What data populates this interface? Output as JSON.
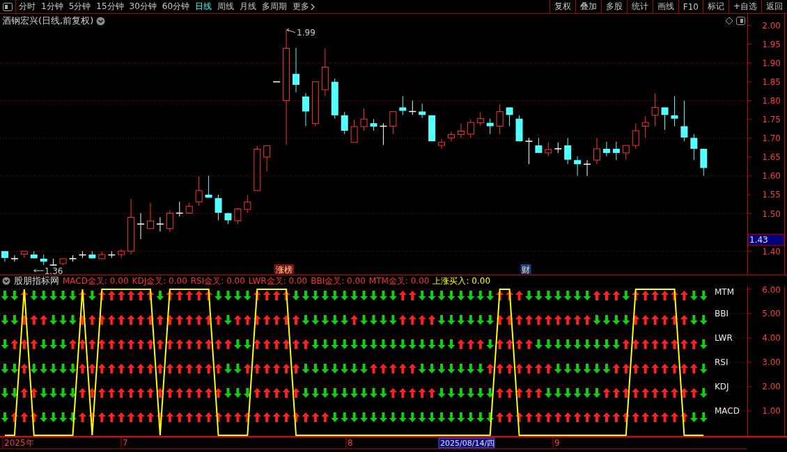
{
  "toolbar": {
    "periods": [
      {
        "label": "分时",
        "selected": false
      },
      {
        "label": "1分钟",
        "selected": false
      },
      {
        "label": "5分钟",
        "selected": false
      },
      {
        "label": "15分钟",
        "selected": false
      },
      {
        "label": "30分钟",
        "selected": false
      },
      {
        "label": "60分钟",
        "selected": false
      },
      {
        "label": "日线",
        "selected": true
      },
      {
        "label": "周线",
        "selected": false
      },
      {
        "label": "月线",
        "selected": false
      },
      {
        "label": "多周期",
        "selected": false
      }
    ],
    "more": "更多",
    "actions": [
      "复权",
      "叠加",
      "多股",
      "统计",
      "画线",
      "F10",
      "标记",
      "+自选",
      "返回"
    ]
  },
  "price_panel": {
    "title": "酒钢宏兴(日线,前复权)",
    "current_price": "1.43",
    "tags": [
      {
        "text": "涨榜",
        "color": "#7a1414"
      },
      {
        "text": "财",
        "color": "#1b3f8f"
      }
    ],
    "chart_data": {
      "type": "candlestick",
      "grid": true,
      "ylim": [
        1.3375,
        2.0304
      ],
      "yticks": [
        {
          "value": 2.0,
          "label": "2.00"
        },
        {
          "value": 1.95,
          "label": "1.95"
        },
        {
          "value": 1.9,
          "label": "1.90"
        },
        {
          "value": 1.85,
          "label": "1.85"
        },
        {
          "value": 1.8,
          "label": "1.80"
        },
        {
          "value": 1.75,
          "label": "1.75"
        },
        {
          "value": 1.7,
          "label": "1.70"
        },
        {
          "value": 1.65,
          "label": "1.65"
        },
        {
          "value": 1.6,
          "label": "1.60"
        },
        {
          "value": 1.55,
          "label": "1.55"
        },
        {
          "value": 1.5,
          "label": "1.50"
        },
        {
          "value": 1.4,
          "label": "1.40"
        }
      ],
      "categories": [
        null,
        null,
        null,
        null,
        null,
        null,
        null,
        null,
        null,
        null,
        null,
        null,
        null,
        null,
        null,
        null,
        null,
        null,
        null,
        null,
        null,
        null,
        null,
        null,
        null,
        null,
        null,
        null,
        null,
        null,
        null,
        null,
        null,
        null,
        null,
        null,
        null,
        null,
        null,
        null,
        null,
        null,
        null,
        null,
        null,
        null,
        null,
        null,
        null,
        null,
        null,
        null,
        null,
        null,
        null,
        null,
        null,
        null,
        null,
        null,
        null,
        null,
        null,
        null,
        null,
        null,
        null,
        null,
        null,
        null,
        null,
        null,
        null,
        null,
        null,
        null,
        null
      ],
      "ohlc": [
        [
          1.4,
          1.4,
          1.372,
          1.382
        ],
        [
          1.38,
          1.389,
          1.372,
          1.38
        ],
        [
          1.392,
          1.4,
          1.382,
          1.4
        ],
        [
          1.391,
          1.4,
          1.381,
          1.381
        ],
        [
          1.38,
          1.391,
          1.363,
          1.372
        ],
        [
          1.363,
          1.38,
          1.363,
          1.363
        ],
        [
          1.367,
          1.38,
          1.363,
          1.38
        ],
        [
          1.38,
          1.389,
          1.372,
          1.38
        ],
        [
          1.39,
          1.4,
          1.382,
          1.39
        ],
        [
          1.391,
          1.4,
          1.381,
          1.381
        ],
        [
          1.38,
          1.4,
          1.38,
          1.391
        ],
        [
          1.39,
          1.4,
          1.382,
          1.39
        ],
        [
          1.391,
          1.405,
          1.382,
          1.4
        ],
        [
          1.4,
          1.539,
          1.392,
          1.49
        ],
        [
          1.472,
          1.501,
          1.432,
          1.472
        ],
        [
          1.46,
          1.529,
          1.46,
          1.48
        ],
        [
          1.472,
          1.49,
          1.452,
          1.472
        ],
        [
          1.46,
          1.509,
          1.452,
          1.501
        ],
        [
          1.501,
          1.531,
          1.492,
          1.501
        ],
        [
          1.501,
          1.529,
          1.501,
          1.519
        ],
        [
          1.531,
          1.599,
          1.521,
          1.561
        ],
        [
          1.55,
          1.6,
          1.542,
          1.542
        ],
        [
          1.541,
          1.55,
          1.482,
          1.502
        ],
        [
          1.501,
          1.501,
          1.472,
          1.482
        ],
        [
          1.481,
          1.515,
          1.472,
          1.512
        ],
        [
          1.511,
          1.549,
          1.502,
          1.531
        ],
        [
          1.561,
          1.679,
          1.561,
          1.671
        ],
        [
          1.65,
          1.68,
          1.612,
          1.68
        ],
        [
          1.85,
          1.85,
          1.85,
          1.85
        ],
        [
          1.8,
          1.99,
          1.682,
          1.939
        ],
        [
          1.871,
          1.94,
          1.822,
          1.842
        ],
        [
          1.811,
          1.82,
          1.732,
          1.771
        ],
        [
          1.739,
          1.85,
          1.732,
          1.85
        ],
        [
          1.829,
          1.939,
          1.812,
          1.889
        ],
        [
          1.85,
          1.859,
          1.752,
          1.761
        ],
        [
          1.761,
          1.77,
          1.711,
          1.72
        ],
        [
          1.689,
          1.749,
          1.689,
          1.731
        ],
        [
          1.731,
          1.779,
          1.72,
          1.751
        ],
        [
          1.74,
          1.751,
          1.72,
          1.731
        ],
        [
          1.732,
          1.74,
          1.682,
          1.732
        ],
        [
          1.732,
          1.771,
          1.711,
          1.771
        ],
        [
          1.782,
          1.812,
          1.762,
          1.773
        ],
        [
          1.771,
          1.8,
          1.762,
          1.771
        ],
        [
          1.771,
          1.792,
          1.754,
          1.762
        ],
        [
          1.761,
          1.761,
          1.692,
          1.692
        ],
        [
          1.681,
          1.698,
          1.672,
          1.689
        ],
        [
          1.701,
          1.718,
          1.692,
          1.71
        ],
        [
          1.71,
          1.739,
          1.701,
          1.719
        ],
        [
          1.711,
          1.75,
          1.701,
          1.742
        ],
        [
          1.741,
          1.769,
          1.733,
          1.752
        ],
        [
          1.741,
          1.752,
          1.711,
          1.732
        ],
        [
          1.732,
          1.79,
          1.711,
          1.771
        ],
        [
          1.782,
          1.782,
          1.732,
          1.762
        ],
        [
          1.752,
          1.761,
          1.692,
          1.692
        ],
        [
          1.692,
          1.701,
          1.631,
          1.692
        ],
        [
          1.681,
          1.701,
          1.661,
          1.661
        ],
        [
          1.661,
          1.689,
          1.652,
          1.67
        ],
        [
          1.672,
          1.689,
          1.661,
          1.672
        ],
        [
          1.681,
          1.701,
          1.631,
          1.643
        ],
        [
          1.642,
          1.652,
          1.6,
          1.631
        ],
        [
          1.631,
          1.642,
          1.6,
          1.631
        ],
        [
          1.642,
          1.701,
          1.631,
          1.672
        ],
        [
          1.672,
          1.691,
          1.652,
          1.661
        ],
        [
          1.672,
          1.691,
          1.642,
          1.661
        ],
        [
          1.661,
          1.681,
          1.643,
          1.681
        ],
        [
          1.681,
          1.739,
          1.672,
          1.72
        ],
        [
          1.732,
          1.759,
          1.701,
          1.742
        ],
        [
          1.761,
          1.819,
          1.732,
          1.782
        ],
        [
          1.782,
          1.782,
          1.722,
          1.762
        ],
        [
          1.761,
          1.812,
          1.732,
          1.752
        ],
        [
          1.732,
          1.8,
          1.692,
          1.702
        ],
        [
          1.701,
          1.711,
          1.642,
          1.672
        ],
        [
          1.672,
          1.672,
          1.6,
          1.621
        ],
        null,
        null,
        null,
        null
      ],
      "annotations": [
        "1.99",
        "1.36"
      ]
    }
  },
  "indicator": {
    "name": "股朋指标网",
    "legend": [
      {
        "text": "MACD金叉: 0.00",
        "color": "#ff3232"
      },
      {
        "text": "KDJ金叉: 0.00",
        "color": "#ff3232"
      },
      {
        "text": "RSI金叉: 0.00",
        "color": "#ff3232"
      },
      {
        "text": "LWR金叉: 0.00",
        "color": "#ff3232"
      },
      {
        "text": "BBI金叉: 0.00",
        "color": "#ff3232"
      },
      {
        "text": "MTM金叉: 0.00",
        "color": "#ff3232"
      },
      {
        "text": "上涨买入: 0.00",
        "color": "#ffff00"
      }
    ],
    "signals": [
      {
        "name": "MTM",
        "up": [
          false,
          false,
          true,
          false,
          false,
          false,
          false,
          false,
          true,
          false,
          true,
          true,
          true,
          true,
          true,
          true,
          false,
          true,
          true,
          true,
          true,
          true,
          false,
          false,
          false,
          false,
          true,
          true,
          true,
          true,
          false,
          false,
          false,
          false,
          false,
          false,
          false,
          false,
          false,
          false,
          false,
          true,
          true,
          false,
          false,
          false,
          false,
          false,
          false,
          false,
          false,
          true,
          true,
          true,
          false,
          false,
          false,
          false,
          false,
          false,
          false,
          true,
          true,
          true,
          false,
          true,
          true,
          true,
          true,
          true,
          true,
          false,
          false
        ]
      },
      {
        "name": "BBI",
        "up": [
          false,
          false,
          true,
          true,
          true,
          false,
          false,
          false,
          true,
          true,
          true,
          true,
          true,
          true,
          true,
          true,
          true,
          true,
          true,
          true,
          true,
          true,
          true,
          false,
          true,
          true,
          true,
          true,
          true,
          true,
          true,
          false,
          false,
          false,
          false,
          false,
          true,
          false,
          false,
          false,
          false,
          true,
          true,
          true,
          true,
          false,
          false,
          false,
          false,
          false,
          false,
          true,
          true,
          true,
          true,
          true,
          true,
          true,
          true,
          true,
          true,
          false,
          false,
          false,
          false,
          true,
          true,
          true,
          true,
          true,
          true,
          false,
          false
        ]
      },
      {
        "name": "LWR",
        "up": [
          false,
          true,
          true,
          true,
          false,
          false,
          false,
          true,
          true,
          true,
          true,
          true,
          true,
          true,
          true,
          true,
          true,
          true,
          true,
          true,
          true,
          true,
          true,
          true,
          false,
          false,
          true,
          true,
          true,
          true,
          true,
          true,
          false,
          false,
          false,
          false,
          false,
          false,
          false,
          false,
          false,
          false,
          false,
          false,
          false,
          false,
          false,
          true,
          true,
          true,
          false,
          true,
          true,
          true,
          true,
          false,
          false,
          false,
          false,
          false,
          false,
          false,
          false,
          false,
          true,
          true,
          true,
          true,
          true,
          true,
          true,
          true,
          false
        ]
      },
      {
        "name": "RSI",
        "up": [
          false,
          false,
          true,
          false,
          false,
          false,
          false,
          false,
          true,
          true,
          true,
          true,
          true,
          true,
          true,
          true,
          true,
          true,
          true,
          true,
          true,
          true,
          true,
          false,
          false,
          true,
          true,
          true,
          true,
          true,
          true,
          false,
          false,
          false,
          false,
          false,
          false,
          false,
          true,
          true,
          true,
          true,
          true,
          false,
          false,
          false,
          false,
          false,
          false,
          false,
          true,
          true,
          true,
          true,
          true,
          true,
          true,
          false,
          false,
          false,
          false,
          false,
          false,
          true,
          true,
          true,
          true,
          true,
          true,
          true,
          true,
          true,
          false
        ]
      },
      {
        "name": "KDJ",
        "up": [
          false,
          false,
          true,
          true,
          false,
          false,
          false,
          false,
          true,
          true,
          true,
          true,
          true,
          true,
          true,
          true,
          true,
          true,
          true,
          true,
          true,
          true,
          true,
          false,
          false,
          false,
          true,
          true,
          true,
          true,
          true,
          false,
          false,
          false,
          false,
          false,
          false,
          false,
          false,
          false,
          true,
          true,
          true,
          true,
          true,
          false,
          false,
          false,
          false,
          false,
          false,
          true,
          true,
          true,
          true,
          true,
          false,
          false,
          false,
          false,
          false,
          false,
          true,
          true,
          true,
          true,
          true,
          true,
          true,
          true,
          true,
          true,
          false
        ]
      },
      {
        "name": "MACD",
        "up": [
          false,
          true,
          true,
          true,
          false,
          false,
          false,
          false,
          true,
          true,
          true,
          true,
          true,
          true,
          true,
          true,
          true,
          true,
          true,
          true,
          true,
          true,
          true,
          true,
          true,
          true,
          true,
          true,
          true,
          true,
          true,
          true,
          true,
          true,
          false,
          false,
          false,
          false,
          false,
          false,
          false,
          false,
          false,
          false,
          false,
          false,
          false,
          false,
          false,
          false,
          false,
          true,
          true,
          true,
          true,
          true,
          true,
          true,
          true,
          true,
          true,
          true,
          true,
          true,
          true,
          true,
          true,
          true,
          true,
          true,
          true,
          false,
          false
        ]
      }
    ],
    "chart_data": {
      "type": "line",
      "grid": true,
      "ylim": [
        -0.03,
        6.114
      ],
      "yticks": [
        {
          "value": 6,
          "label": "6.00"
        },
        {
          "value": 5,
          "label": "5.00"
        },
        {
          "value": 4,
          "label": "4.00"
        },
        {
          "value": 3,
          "label": "3.00"
        },
        {
          "value": 2,
          "label": "2.00"
        },
        {
          "value": 1,
          "label": "1.00"
        }
      ],
      "series": [
        {
          "color": "#ffff00",
          "values": [
            0,
            0,
            6,
            0,
            0,
            0,
            0,
            0,
            6,
            0,
            6,
            6,
            6,
            6,
            6,
            6,
            0,
            6,
            6,
            6,
            6,
            6,
            0,
            0,
            0,
            0,
            6,
            6,
            6,
            6,
            0,
            0,
            0,
            0,
            0,
            0,
            0,
            0,
            0,
            0,
            0,
            0,
            0,
            0,
            0,
            0,
            0,
            0,
            0,
            0,
            0,
            6,
            6,
            0,
            0,
            0,
            0,
            0,
            0,
            0,
            0,
            0,
            0,
            0,
            0,
            6,
            6,
            6,
            6,
            6,
            0,
            0,
            0
          ]
        }
      ]
    }
  },
  "time_axis": {
    "labels": [
      "2025年",
      "7",
      "8",
      "9"
    ],
    "cursor_date": "2025/08/14/四"
  }
}
